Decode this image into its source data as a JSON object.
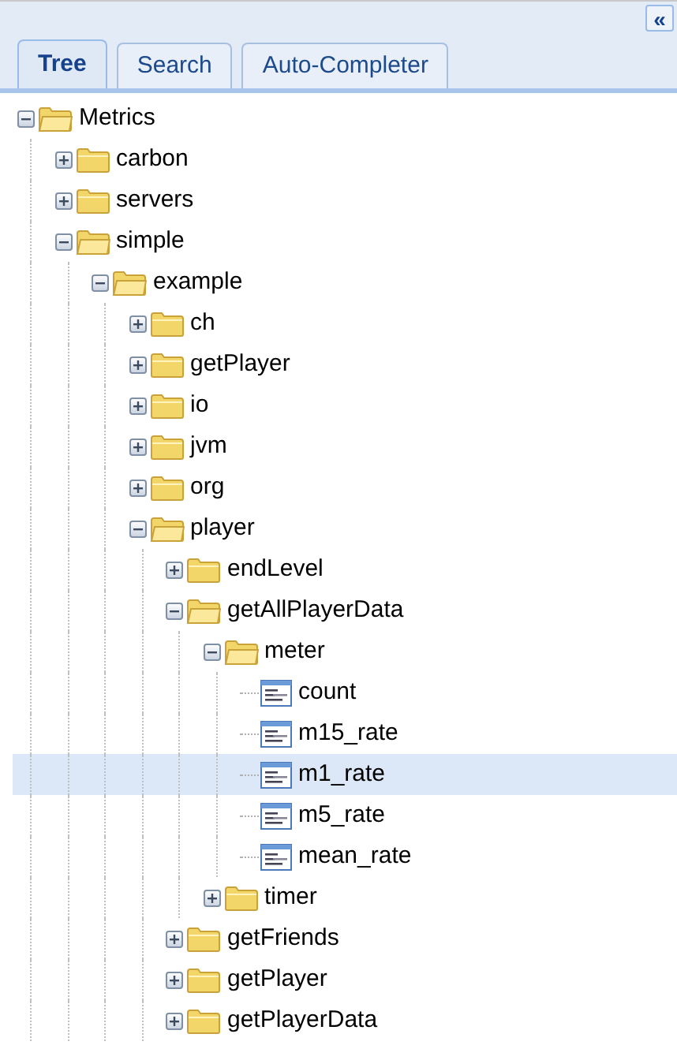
{
  "collapse_button": {
    "label": "«"
  },
  "tabs": [
    {
      "label": "Tree",
      "selected": true
    },
    {
      "label": "Search",
      "selected": false
    },
    {
      "label": "Auto-Completer",
      "selected": false
    }
  ],
  "tree": [
    {
      "label": "Metrics",
      "kind": "folder",
      "expanded": true,
      "selected": false,
      "children": [
        {
          "label": "carbon",
          "kind": "folder",
          "expanded": false,
          "selected": false
        },
        {
          "label": "servers",
          "kind": "folder",
          "expanded": false,
          "selected": false
        },
        {
          "label": "simple",
          "kind": "folder",
          "expanded": true,
          "selected": false,
          "children": [
            {
              "label": "example",
              "kind": "folder",
              "expanded": true,
              "selected": false,
              "children": [
                {
                  "label": "ch",
                  "kind": "folder",
                  "expanded": false,
                  "selected": false
                },
                {
                  "label": "getPlayer",
                  "kind": "folder",
                  "expanded": false,
                  "selected": false
                },
                {
                  "label": "io",
                  "kind": "folder",
                  "expanded": false,
                  "selected": false
                },
                {
                  "label": "jvm",
                  "kind": "folder",
                  "expanded": false,
                  "selected": false
                },
                {
                  "label": "org",
                  "kind": "folder",
                  "expanded": false,
                  "selected": false
                },
                {
                  "label": "player",
                  "kind": "folder",
                  "expanded": true,
                  "selected": false,
                  "children": [
                    {
                      "label": "endLevel",
                      "kind": "folder",
                      "expanded": false,
                      "selected": false
                    },
                    {
                      "label": "getAllPlayerData",
                      "kind": "folder",
                      "expanded": true,
                      "selected": false,
                      "children": [
                        {
                          "label": "meter",
                          "kind": "folder",
                          "expanded": true,
                          "selected": false,
                          "children": [
                            {
                              "label": "count",
                              "kind": "leaf",
                              "selected": false
                            },
                            {
                              "label": "m15_rate",
                              "kind": "leaf",
                              "selected": false
                            },
                            {
                              "label": "m1_rate",
                              "kind": "leaf",
                              "selected": true
                            },
                            {
                              "label": "m5_rate",
                              "kind": "leaf",
                              "selected": false
                            },
                            {
                              "label": "mean_rate",
                              "kind": "leaf",
                              "selected": false
                            }
                          ]
                        },
                        {
                          "label": "timer",
                          "kind": "folder",
                          "expanded": false,
                          "selected": false
                        }
                      ]
                    },
                    {
                      "label": "getFriends",
                      "kind": "folder",
                      "expanded": false,
                      "selected": false
                    },
                    {
                      "label": "getPlayer",
                      "kind": "folder",
                      "expanded": false,
                      "selected": false
                    },
                    {
                      "label": "getPlayerData",
                      "kind": "folder",
                      "expanded": false,
                      "selected": false
                    }
                  ]
                }
              ]
            }
          ]
        }
      ]
    }
  ]
}
